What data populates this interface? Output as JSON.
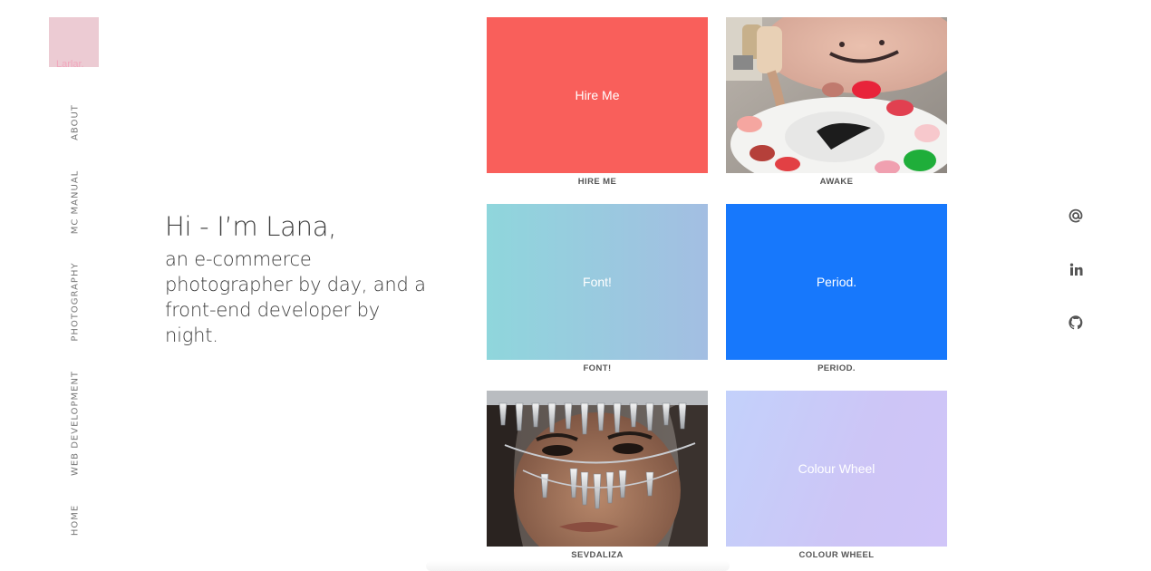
{
  "logo": {
    "text": "Larlar."
  },
  "nav": {
    "items": [
      {
        "id": "about",
        "label": "ABOUT"
      },
      {
        "id": "mc-manual",
        "label": "MC MANUAL"
      },
      {
        "id": "photography",
        "label": "PHOTOGRAPHY"
      },
      {
        "id": "web-development",
        "label": "WEB DEVELOPMENT"
      },
      {
        "id": "home",
        "label": "HOME"
      }
    ]
  },
  "intro": {
    "title": "Hi - I’m Lana,",
    "body": "an e-commerce photographer by day, and a front-end developer by night."
  },
  "tiles": [
    {
      "id": "hire-me",
      "face_text": "Hire Me",
      "caption": "HIRE ME",
      "kind": "color",
      "color": "#f95f5b"
    },
    {
      "id": "awake",
      "face_text": "",
      "caption": "AWAKE",
      "kind": "photo",
      "photo_subject": "paint-palette-photo"
    },
    {
      "id": "font",
      "face_text": "Font!",
      "caption": "FONT!",
      "kind": "gradient",
      "colors": [
        "#8fd6dc",
        "#a3bee2"
      ]
    },
    {
      "id": "period",
      "face_text": "Period.",
      "caption": "PERIOD.",
      "kind": "color",
      "color": "#1778fc"
    },
    {
      "id": "sevdaliza",
      "face_text": "",
      "caption": "SEVDALIZA",
      "kind": "photo",
      "photo_subject": "crystal-mask-portrait-photo"
    },
    {
      "id": "colour-wheel",
      "face_text": "Colour Wheel",
      "caption": "COLOUR WHEEL",
      "kind": "gradient",
      "colors": [
        "#c3d1fb",
        "#d0c5f8"
      ]
    }
  ],
  "social": [
    {
      "id": "email",
      "icon": "at-icon"
    },
    {
      "id": "linkedin",
      "icon": "linkedin-icon"
    },
    {
      "id": "github",
      "icon": "github-icon"
    }
  ],
  "colors": {
    "logo_bg": "#eccbd3",
    "logo_text": "#f0a7bd",
    "text": "#3e3e3e",
    "nav": "#777777"
  }
}
